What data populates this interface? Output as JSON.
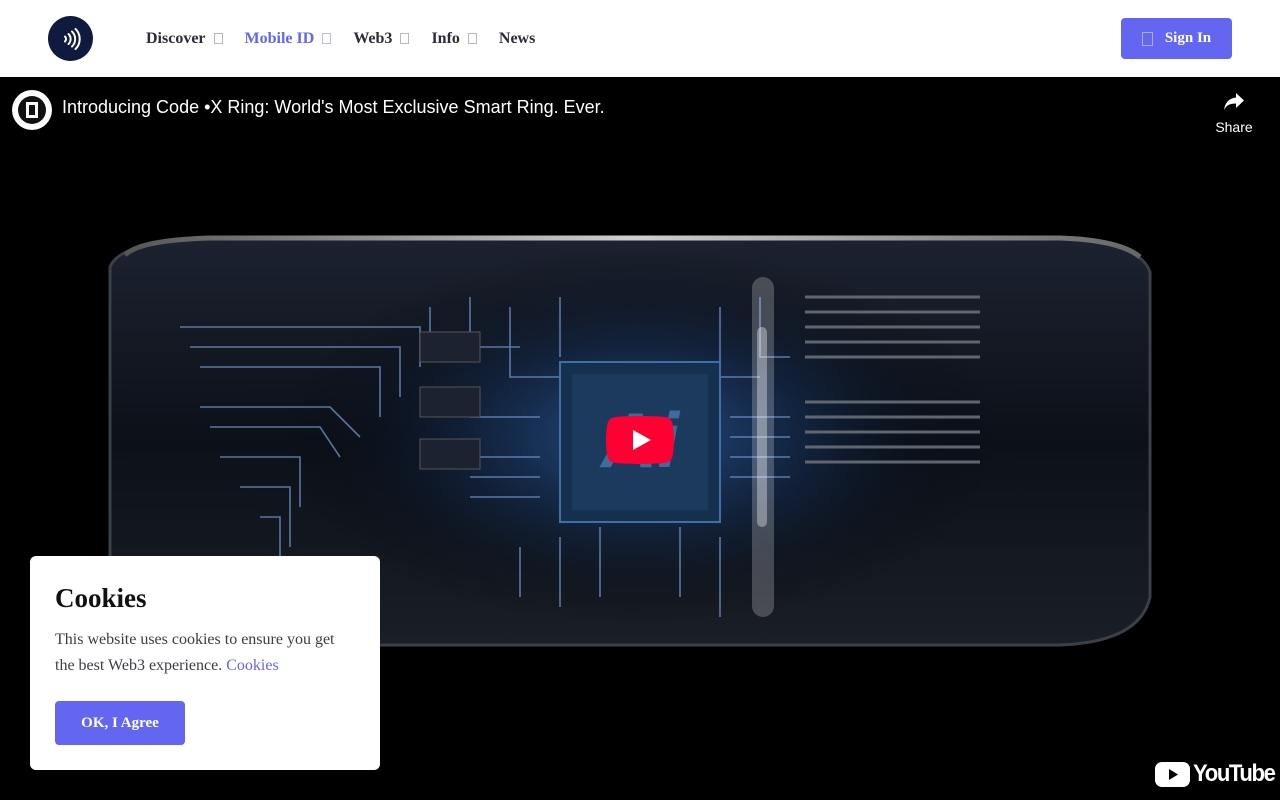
{
  "header": {
    "nav": [
      {
        "label": "Discover",
        "has_menu": true
      },
      {
        "label": "Mobile ID",
        "has_menu": true,
        "active": true
      },
      {
        "label": "Web3",
        "has_menu": true
      },
      {
        "label": "Info",
        "has_menu": true
      },
      {
        "label": "News",
        "has_menu": false
      }
    ],
    "signin_label": "Sign In",
    "logo_icon": "contactless-icon"
  },
  "video": {
    "title": "Introducing Code •X Ring: World's Most Exclusive Smart Ring. Ever.",
    "share_label": "Share",
    "platform": "YouTube",
    "chip_text": "Ai"
  },
  "cookie": {
    "title": "Cookies",
    "text": "This website uses cookies to ensure you get the best Web3 experience.",
    "link": "Cookies",
    "button": "OK, I Agree"
  },
  "colors": {
    "accent": "#6366f1",
    "youtube_red": "#ff0033",
    "logo_bg": "#101a3f"
  }
}
